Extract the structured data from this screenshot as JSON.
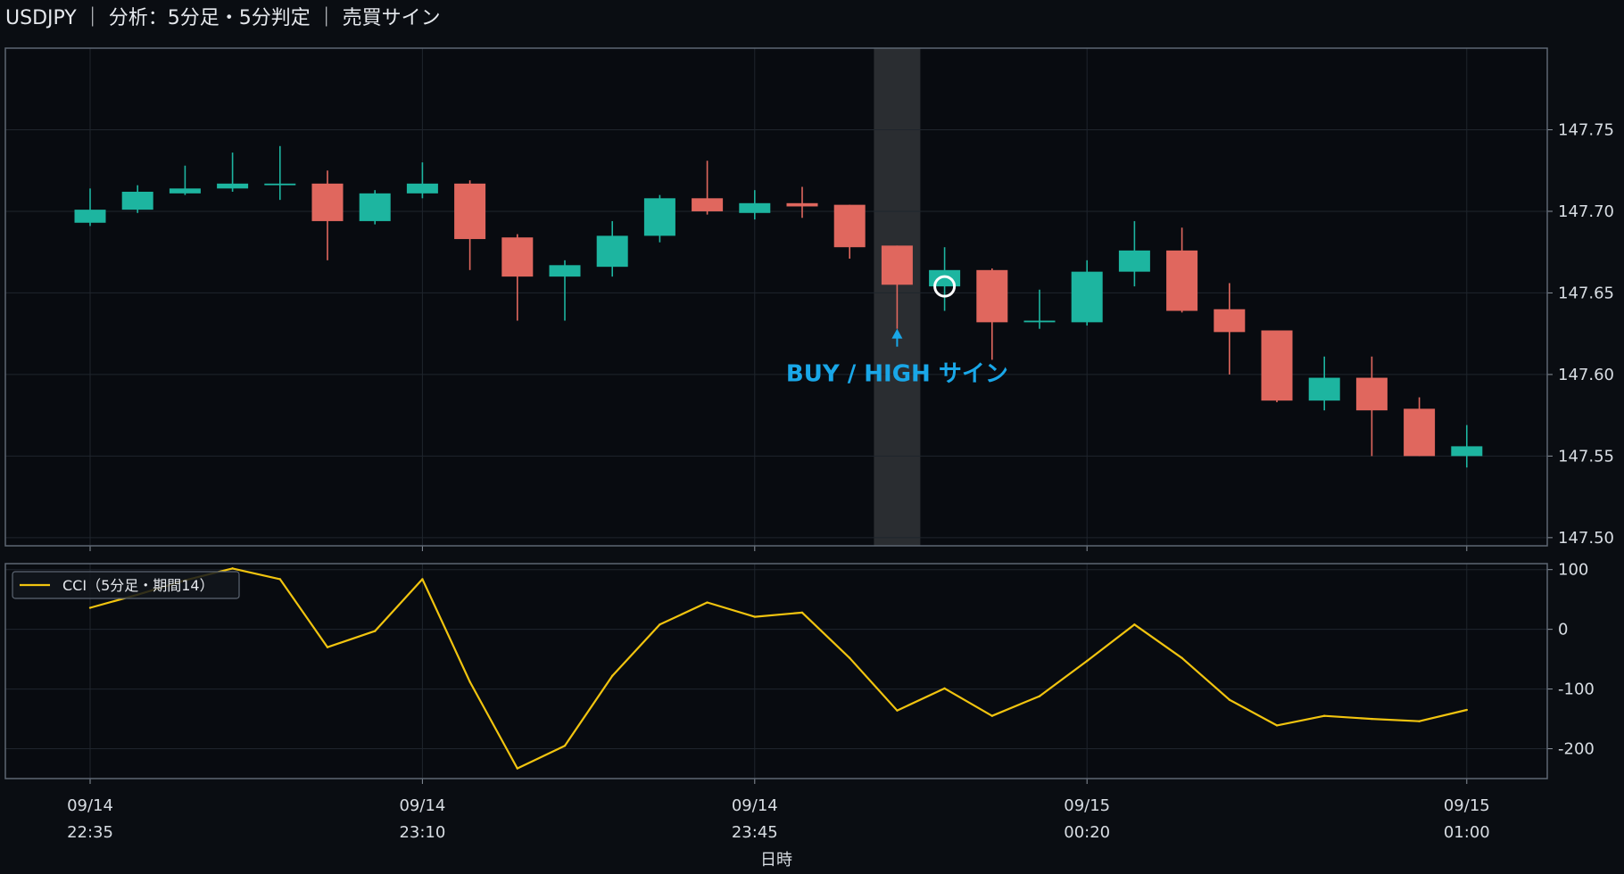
{
  "header": {
    "title": "USDJPY ｜ 分析：5分足・5分判定 ｜ 売買サイン"
  },
  "colors": {
    "background": "#0a0d12",
    "up": "#1db5a0",
    "down": "#e0675e",
    "cci_line": "#f1c40f",
    "signal": "#19a7e8",
    "highlight_band": "#2a2d31",
    "grid": "#1f252d",
    "frame": "#5d6673"
  },
  "chart_data": [
    {
      "type": "candlestick",
      "title": "",
      "ylim": [
        147.495,
        147.8
      ],
      "y_ticks": [
        "147.50",
        "147.55",
        "147.60",
        "147.65",
        "147.70",
        "147.75"
      ],
      "grid": true,
      "highlight_index": 17,
      "candles": [
        {
          "o": 147.693,
          "h": 147.714,
          "l": 147.691,
          "c": 147.701
        },
        {
          "o": 147.701,
          "h": 147.716,
          "l": 147.699,
          "c": 147.712
        },
        {
          "o": 147.711,
          "h": 147.728,
          "l": 147.71,
          "c": 147.714
        },
        {
          "o": 147.714,
          "h": 147.736,
          "l": 147.712,
          "c": 147.717
        },
        {
          "o": 147.716,
          "h": 147.74,
          "l": 147.707,
          "c": 147.717
        },
        {
          "o": 147.717,
          "h": 147.725,
          "l": 147.67,
          "c": 147.694
        },
        {
          "o": 147.694,
          "h": 147.713,
          "l": 147.692,
          "c": 147.711
        },
        {
          "o": 147.711,
          "h": 147.73,
          "l": 147.708,
          "c": 147.717
        },
        {
          "o": 147.717,
          "h": 147.719,
          "l": 147.664,
          "c": 147.683
        },
        {
          "o": 147.684,
          "h": 147.686,
          "l": 147.633,
          "c": 147.66
        },
        {
          "o": 147.66,
          "h": 147.67,
          "l": 147.633,
          "c": 147.667
        },
        {
          "o": 147.666,
          "h": 147.694,
          "l": 147.66,
          "c": 147.685
        },
        {
          "o": 147.685,
          "h": 147.71,
          "l": 147.681,
          "c": 147.708
        },
        {
          "o": 147.708,
          "h": 147.731,
          "l": 147.698,
          "c": 147.7
        },
        {
          "o": 147.699,
          "h": 147.713,
          "l": 147.695,
          "c": 147.705
        },
        {
          "o": 147.705,
          "h": 147.715,
          "l": 147.696,
          "c": 147.703
        },
        {
          "o": 147.704,
          "h": 147.704,
          "l": 147.671,
          "c": 147.678
        },
        {
          "o": 147.679,
          "h": 147.679,
          "l": 147.628,
          "c": 147.655
        },
        {
          "o": 147.654,
          "h": 147.678,
          "l": 147.639,
          "c": 147.664
        },
        {
          "o": 147.664,
          "h": 147.665,
          "l": 147.609,
          "c": 147.632
        },
        {
          "o": 147.632,
          "h": 147.652,
          "l": 147.628,
          "c": 147.633
        },
        {
          "o": 147.632,
          "h": 147.67,
          "l": 147.63,
          "c": 147.663
        },
        {
          "o": 147.663,
          "h": 147.694,
          "l": 147.654,
          "c": 147.676
        },
        {
          "o": 147.676,
          "h": 147.69,
          "l": 147.638,
          "c": 147.639
        },
        {
          "o": 147.64,
          "h": 147.656,
          "l": 147.6,
          "c": 147.626
        },
        {
          "o": 147.627,
          "h": 147.627,
          "l": 147.583,
          "c": 147.584
        },
        {
          "o": 147.584,
          "h": 147.611,
          "l": 147.578,
          "c": 147.598
        },
        {
          "o": 147.598,
          "h": 147.611,
          "l": 147.55,
          "c": 147.578
        },
        {
          "o": 147.579,
          "h": 147.586,
          "l": 147.55,
          "c": 147.55
        },
        {
          "o": 147.55,
          "h": 147.569,
          "l": 147.543,
          "c": 147.556
        }
      ],
      "signal": {
        "label": "BUY / HIGH サイン",
        "arrow_index": 17,
        "arrow_value": 147.628,
        "marker_index": 18,
        "marker_value": 147.654
      }
    },
    {
      "type": "line",
      "legend": "CCI（5分足・期間14）",
      "legend_position": "top-left",
      "ylim": [
        -250,
        110
      ],
      "y_ticks": [
        "100",
        "0",
        "-100",
        "-200"
      ],
      "series": [
        {
          "name": "CCI（5分足・期間14）",
          "values": [
            36,
            58,
            82,
            102,
            84,
            -30,
            -3,
            84,
            -88,
            -233,
            -195,
            -78,
            8,
            45,
            21,
            28,
            -48,
            -136,
            -99,
            -145,
            -112,
            -53,
            8,
            -48,
            -118,
            -161,
            -145,
            -150,
            -154,
            -135
          ]
        }
      ]
    }
  ],
  "x_axis": {
    "label": "日時",
    "ticks": [
      {
        "index": 0,
        "date": "09/14",
        "time": "22:35"
      },
      {
        "index": 7,
        "date": "09/14",
        "time": "23:10"
      },
      {
        "index": 14,
        "date": "09/14",
        "time": "23:45"
      },
      {
        "index": 21,
        "date": "09/15",
        "time": "00:20"
      },
      {
        "index": 29,
        "date": "09/15",
        "time": "01:00"
      }
    ]
  }
}
